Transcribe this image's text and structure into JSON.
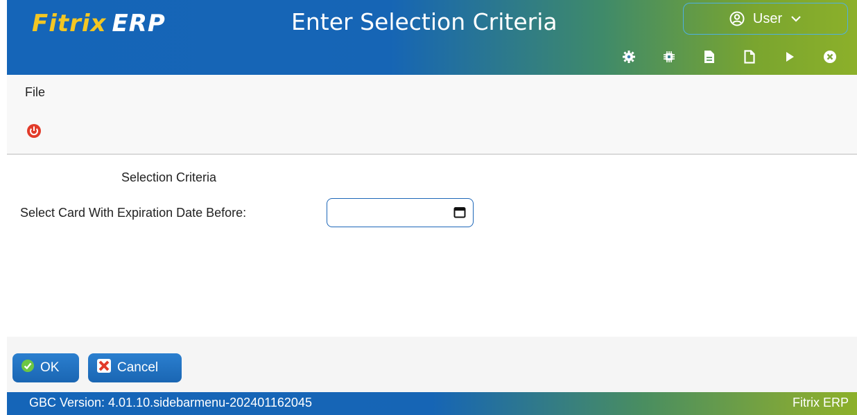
{
  "header": {
    "logo_brand": "Fitrix",
    "logo_suffix": "ERP",
    "title": "Enter Selection Criteria",
    "user_label": "User",
    "toolbar_icons": [
      "settings-icon",
      "chip-icon",
      "document-icon",
      "new-page-icon",
      "play-icon",
      "close-circle-icon"
    ]
  },
  "menu": {
    "file_label": "File"
  },
  "form": {
    "section_title": "Selection Criteria",
    "expiration_label": "Select Card With Expiration Date Before:",
    "expiration_value": ""
  },
  "buttons": {
    "ok_label": "OK",
    "cancel_label": "Cancel"
  },
  "status": {
    "version": "GBC Version: 4.01.10.sidebarmenu-202401162045",
    "product": "Fitrix ERP"
  },
  "colors": {
    "primary_blue": "#1565b8",
    "accent_green": "#8cb02a",
    "logo_yellow": "#f3c623",
    "power_red": "#e23b2a"
  }
}
